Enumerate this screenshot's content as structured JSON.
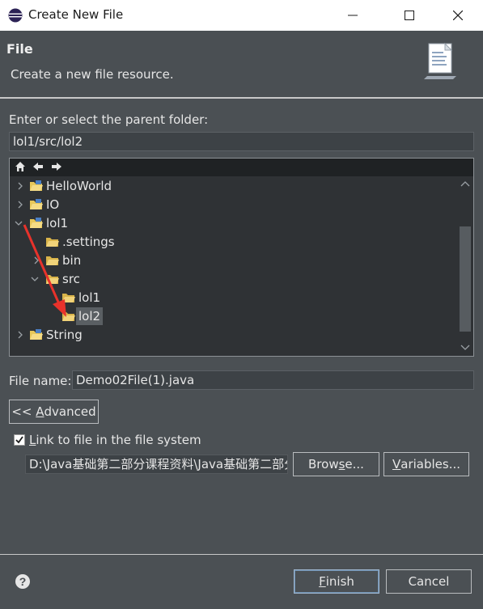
{
  "window": {
    "title": "Create New File"
  },
  "header": {
    "title": "File",
    "description": "Create a new file resource."
  },
  "parent_folder": {
    "label": "Enter or select the parent folder:",
    "value": "lol1/src/lol2"
  },
  "tree": {
    "items": [
      {
        "label": "HelloWorld",
        "level": 0,
        "expanded": false,
        "type": "project"
      },
      {
        "label": "IO",
        "level": 0,
        "expanded": false,
        "type": "project"
      },
      {
        "label": "lol1",
        "level": 0,
        "expanded": true,
        "type": "project"
      },
      {
        "label": ".settings",
        "level": 1,
        "type": "folder"
      },
      {
        "label": "bin",
        "level": 1,
        "expanded": false,
        "type": "folder"
      },
      {
        "label": "src",
        "level": 1,
        "expanded": true,
        "type": "folder"
      },
      {
        "label": "lol1",
        "level": 2,
        "type": "folder"
      },
      {
        "label": "lol2",
        "level": 2,
        "type": "folder",
        "selected": true
      },
      {
        "label": "String",
        "level": 0,
        "expanded": false,
        "type": "project"
      }
    ]
  },
  "file_name": {
    "label": "File name:",
    "value": "Demo02File(1).java"
  },
  "advanced_button": {
    "prefix": "<< ",
    "accel": "A",
    "rest": "dvanced"
  },
  "link": {
    "checked": true,
    "accel": "L",
    "rest": "ink to file in the file system",
    "path": "D:\\Java基础第二部分课程资料\\Java基础第二部分"
  },
  "browse_button": {
    "pre": "Brow",
    "accel": "s",
    "post": "e..."
  },
  "variables_button": {
    "accel": "V",
    "rest": "ariables..."
  },
  "finish_button": {
    "accel": "F",
    "rest": "inish"
  },
  "cancel_button": {
    "label": "Cancel"
  },
  "colors": {
    "background": "#4b5054",
    "header": "#4a4f53",
    "tree_bg": "#2f3235",
    "arrow_annotation": "#e8322b"
  }
}
